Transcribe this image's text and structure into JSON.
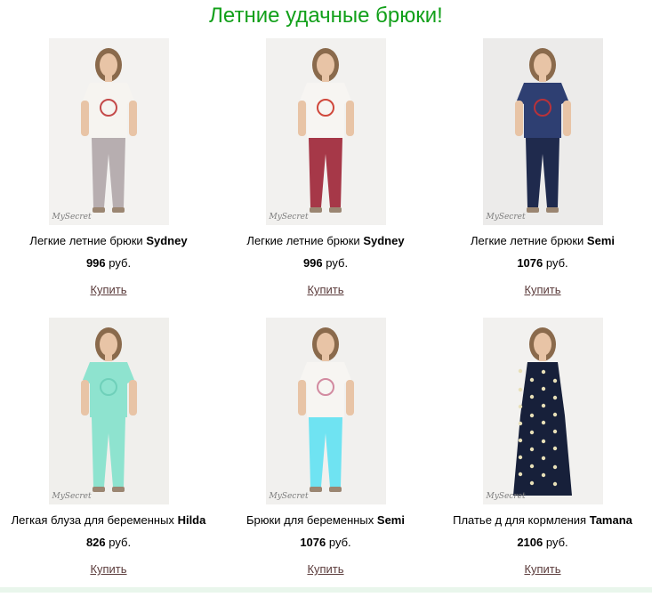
{
  "page": {
    "title": "Летние удачные брюки!"
  },
  "watermark": "MySecret",
  "products": [
    {
      "name": "Легкие летние брюки",
      "model": "Sydney",
      "price": "996",
      "currency": "руб.",
      "buy_label": "Купить",
      "bg": "#f3f2f0",
      "top": "#f6f4f0",
      "bottom": "#b7aeb0",
      "accent": "#c44a4a"
    },
    {
      "name": "Легкие летние брюки",
      "model": "Sydney",
      "price": "996",
      "currency": "руб.",
      "buy_label": "Купить",
      "bg": "#f2f1ef",
      "top": "#f7f5f2",
      "bottom": "#a63848",
      "accent": "#d0483c"
    },
    {
      "name": "Легкие летние брюки",
      "model": "Semi",
      "price": "1076",
      "currency": "руб.",
      "buy_label": "Купить",
      "bg": "#ecebea",
      "top": "#2e3f72",
      "bottom": "#1f2a4d",
      "accent": "#b8323a"
    },
    {
      "name": "Легкая блуза для беременных",
      "model": "Hilda",
      "price": "826",
      "currency": "руб.",
      "buy_label": "Купить",
      "bg": "#f0efec",
      "top": "#8ee3cf",
      "bottom": "#8ee3cf",
      "accent": "#6fd0ba"
    },
    {
      "name": "Брюки для беременных",
      "model": "Semi",
      "price": "1076",
      "currency": "руб.",
      "buy_label": "Купить",
      "bg": "#f1f0ee",
      "top": "#f7f5f2",
      "bottom": "#6fe3f2",
      "accent": "#d28aa0"
    },
    {
      "name": "Платье д для кормления",
      "model": "Tamana",
      "price": "2106",
      "currency": "руб.",
      "buy_label": "Купить",
      "bg": "#f2f1ef",
      "top": "#17203a",
      "bottom": "#17203a",
      "accent": "#e8e0b8"
    }
  ]
}
